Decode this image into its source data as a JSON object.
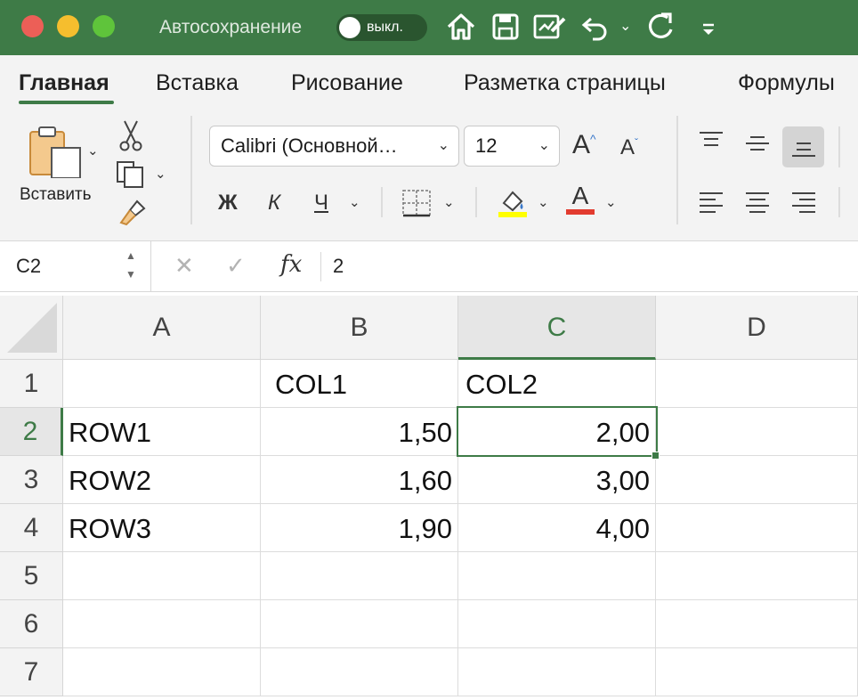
{
  "app": {
    "autosave_label": "Автосохранение",
    "autosave_state": "выкл."
  },
  "ribbon": {
    "tabs": [
      "Главная",
      "Вставка",
      "Рисование",
      "Разметка страницы",
      "Формулы"
    ],
    "active_tab": "Главная",
    "paste_label": "Вставить",
    "font_name": "Calibri (Основной…",
    "font_size": "12",
    "bold": "Ж",
    "italic": "К",
    "underline": "Ч",
    "increase_font": "A",
    "decrease_font": "A",
    "font_color_letter": "A",
    "highlight_color": "#ffff00",
    "font_color": "#e23b2f"
  },
  "formula_bar": {
    "cell_ref": "C2",
    "fx": "fx",
    "content": "2"
  },
  "sheet": {
    "columns": [
      "A",
      "B",
      "C",
      "D"
    ],
    "rows": [
      "1",
      "2",
      "3",
      "4",
      "5",
      "6",
      "7"
    ],
    "selected_cell": "C2",
    "cells": {
      "B1": "COL1",
      "C1": "COL2",
      "A2": "ROW1",
      "B2": "1,50",
      "C2": "2,00",
      "A3": "ROW2",
      "B3": "1,60",
      "C3": "3,00",
      "A4": "ROW3",
      "B4": "1,90",
      "C4": "4,00"
    }
  },
  "colors": {
    "accent": "#3e7b47",
    "titlebar": "#3e7b47"
  }
}
